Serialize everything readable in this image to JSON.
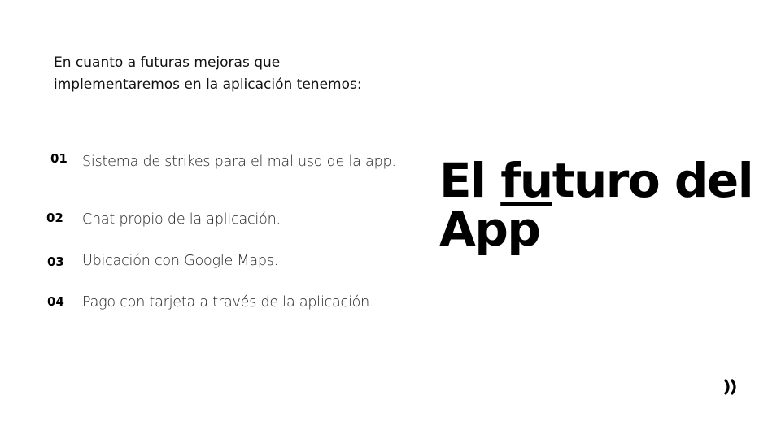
{
  "intro": {
    "line1": "En cuanto a futuras mejoras que",
    "line2": "implementaremos en la aplicación tenemos:"
  },
  "items": [
    {
      "number": "01",
      "text": "Sistema de strikes para el mal uso de la app."
    },
    {
      "number": "02",
      "text": "Chat propio de la aplicación."
    },
    {
      "number": "03",
      "text": "Ubicación con Google Maps."
    },
    {
      "number": "04",
      "text": "Pago con tarjeta a través de la aplicación."
    }
  ],
  "title": {
    "part1": "El ",
    "underlined": "fu",
    "part2": "turo del",
    "line2": "App"
  },
  "next_icon": "double-chevron-right-icon",
  "colors": {
    "background": "#ffffff",
    "text": "#000000"
  }
}
